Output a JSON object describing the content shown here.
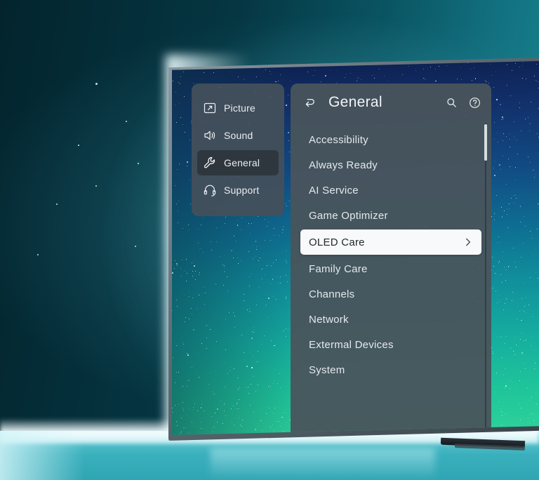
{
  "device": {
    "type": "oled-television",
    "wallpaper": "starfield-gradient"
  },
  "sidebar": {
    "items": [
      {
        "label": "Picture",
        "icon": "picture-icon",
        "active": false
      },
      {
        "label": "Sound",
        "icon": "speaker-icon",
        "active": false
      },
      {
        "label": "General",
        "icon": "wrench-icon",
        "active": true
      },
      {
        "label": "Support",
        "icon": "headset-icon",
        "active": false
      }
    ]
  },
  "panel": {
    "back_icon": "back-arrow-icon",
    "title": "General",
    "search_icon": "search-icon",
    "help_icon": "help-circle-icon",
    "items": [
      {
        "label": "Accessibility",
        "selected": false
      },
      {
        "label": "Always Ready",
        "selected": false
      },
      {
        "label": "AI Service",
        "selected": false
      },
      {
        "label": "Game Optimizer",
        "selected": false
      },
      {
        "label": "OLED Care",
        "selected": true,
        "chevron": "chevron-right-icon"
      },
      {
        "label": "Family Care",
        "selected": false
      },
      {
        "label": "Channels",
        "selected": false
      },
      {
        "label": "Network",
        "selected": false
      },
      {
        "label": "Extermal Devices",
        "selected": false
      },
      {
        "label": "System",
        "selected": false
      }
    ],
    "scrollbar": {
      "position": "top"
    }
  },
  "colors": {
    "panel_bg": "#49545c",
    "sidebar_bg": "#44505a",
    "selected_row_bg": "#f7f9fa",
    "selected_row_text": "#22292e",
    "text": "#e4e9ec",
    "sidebar_active_bg": "#2c353c",
    "room_accent": "#2fa5b3"
  }
}
